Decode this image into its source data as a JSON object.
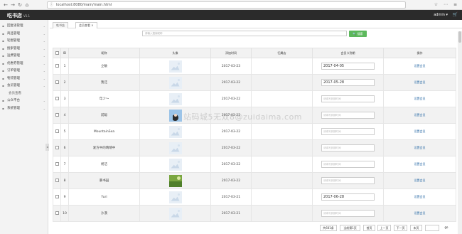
{
  "browser": {
    "url": "localhost:8080/main/main.html"
  },
  "app": {
    "title": "吃书店",
    "version": "V1.1",
    "admin": "admin"
  },
  "sidebar": {
    "items": [
      {
        "label": "回复语管理",
        "sub": false
      },
      {
        "label": "商品管理",
        "sub": false
      },
      {
        "label": "轮图管理",
        "sub": false
      },
      {
        "label": "搜索管理",
        "sub": false
      },
      {
        "label": "运费管理",
        "sub": false
      },
      {
        "label": "优惠券管理",
        "sub": false
      },
      {
        "label": "订单管理",
        "sub": false
      },
      {
        "label": "物流管理",
        "sub": false
      },
      {
        "label": "会员管理",
        "sub": false
      },
      {
        "label": "会员查看",
        "sub": true
      },
      {
        "label": "公众平台",
        "sub": false
      },
      {
        "label": "系统管理",
        "sub": false
      }
    ]
  },
  "tabs": [
    {
      "label": "吃书店"
    },
    {
      "label": "会员查看"
    }
  ],
  "search": {
    "placeholder": "请输入搜索昵称",
    "button": "搜索"
  },
  "table": {
    "headers": [
      "ID",
      "昵称",
      "头像",
      "添加时间",
      "归属店",
      "会员卡到期",
      "操作"
    ],
    "rows": [
      {
        "id": "1",
        "name": "立敏",
        "avatar": "placeholder",
        "date": "2017-03-23",
        "expiry": "2017-04-05",
        "op": "设置会员"
      },
      {
        "id": "2",
        "name": "我泛",
        "avatar": "placeholder",
        "date": "2017-03-22",
        "expiry": "2017-05-28",
        "op": "设置会员"
      },
      {
        "id": "3",
        "name": "年少～",
        "avatar": "placeholder",
        "date": "2017-03-22",
        "expiry": "",
        "op": "设置会员"
      },
      {
        "id": "4",
        "name": "前聪",
        "avatar": "face",
        "date": "2017-03-22",
        "expiry": "",
        "op": "设置会员"
      },
      {
        "id": "5",
        "name": "MountainSea",
        "avatar": "placeholder",
        "date": "2017-03-22",
        "expiry": "",
        "op": "设置会员"
      },
      {
        "id": "6",
        "name": "爱方中的晴晴中",
        "avatar": "placeholder",
        "date": "2017-03-22",
        "expiry": "",
        "op": "设置会员"
      },
      {
        "id": "7",
        "name": "杨洁",
        "avatar": "placeholder",
        "date": "2017-03-22",
        "expiry": "",
        "op": "设置会员"
      },
      {
        "id": "8",
        "name": "暴书园",
        "avatar": "land",
        "date": "2017-03-22",
        "expiry": "",
        "op": "设置会员"
      },
      {
        "id": "9",
        "name": "Yuri",
        "avatar": "placeholder",
        "date": "2017-03-21",
        "expiry": "2017-06-28",
        "op": "设置会员"
      },
      {
        "id": "10",
        "name": "沙漠",
        "avatar": "placeholder",
        "date": "2017-03-21",
        "expiry": "",
        "op": "设置会员"
      }
    ],
    "expiry_placeholder": "请填写到期时间"
  },
  "pager": {
    "total": "共601条",
    "current": "当前第1页",
    "first": "首页",
    "prev": "上一页",
    "next": "下一页",
    "last": "末页",
    "go": "go"
  },
  "watermark": "站码城5无双8@zuidaima.com"
}
